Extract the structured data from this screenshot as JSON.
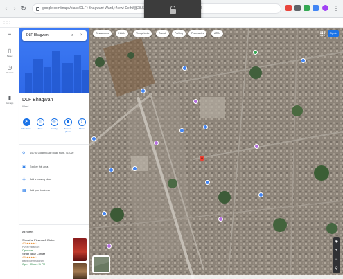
{
  "browser": {
    "url": "google.com/maps/place/DLF+Bhagwan+Ward,+New+Delhi/@28.55,77.20,17z/data=!3m1!1e3!4m5!3m4"
  },
  "overlay": {
    "caption": "Screen locked"
  },
  "left_rail": {
    "items": [
      {
        "label": "Saved"
      },
      {
        "label": "Recents"
      },
      {
        "label": "Get app"
      }
    ]
  },
  "search": {
    "value": "DLF Bhagwan"
  },
  "place": {
    "title": "DLF Bhagwan",
    "subtitle": "Ward",
    "actions": [
      {
        "label": "Directions"
      },
      {
        "label": "Save"
      },
      {
        "label": "Nearby"
      },
      {
        "label": "Send to phone"
      },
      {
        "label": "Share"
      }
    ],
    "info": [
      {
        "text": "4/1780 Golden Gate Road Pune, 411020"
      },
      {
        "text": "Explore this area"
      },
      {
        "text": "Add a missing place"
      },
      {
        "text": "Add your business"
      }
    ]
  },
  "nearby": {
    "heading": "All hotels",
    "items": [
      {
        "name": "Shrestha Pizzeria & Bistro",
        "rating": "4.2 ★★★★☆",
        "type": "Pizza restaurant",
        "status": "Open now"
      },
      {
        "name": "Singh BBQ Corner",
        "rating": "4.0 ★★★★☆",
        "type": "Barbecue restaurant",
        "status": "Open · Closes 11 PM"
      }
    ]
  },
  "map": {
    "chips": [
      {
        "label": "Restaurants"
      },
      {
        "label": "Hotels"
      },
      {
        "label": "Things to do"
      },
      {
        "label": "Transit"
      },
      {
        "label": "Parking"
      },
      {
        "label": "Pharmacies"
      },
      {
        "label": "ATMs"
      }
    ],
    "signin_label": "Sign in",
    "zoom_in": "+",
    "zoom_out": "−"
  },
  "colors": {
    "accent": "#1a73e8",
    "pin": "#ea4335",
    "poi_purple": "#b46ee0",
    "poi_blue": "#4285f4"
  },
  "icons": {
    "search": "search-icon",
    "directions": "directions-icon",
    "location": "location-pin-icon",
    "layers": "layers-icon"
  }
}
